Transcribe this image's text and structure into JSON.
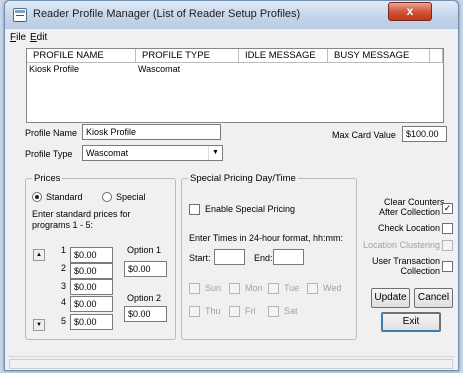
{
  "window": {
    "title": "Reader Profile Manager (List of Reader Setup Profiles)",
    "close_glyph": "x"
  },
  "menu": {
    "file": "File",
    "file_key": "F",
    "file_rest": "ile",
    "edit": "Edit",
    "edit_key": "E",
    "edit_rest": "dit"
  },
  "list": {
    "headers": [
      "PROFILE NAME",
      "PROFILE TYPE",
      "IDLE MESSAGE",
      "BUSY MESSAGE"
    ],
    "rows": [
      [
        "Kiosk Profile",
        "Wascomat",
        "",
        ""
      ]
    ]
  },
  "form": {
    "profile_name_label": "Profile Name",
    "profile_name_value": "Kiosk Profile",
    "profile_type_label": "Profile Type",
    "profile_type_value": "Wascomat",
    "max_card_label": "Max Card Value",
    "max_card_value": "$100.00"
  },
  "prices": {
    "title": "Prices",
    "standard_label": "Standard",
    "special_label": "Special",
    "selected": "standard",
    "instructions": "Enter standard prices for programs 1 - 5:",
    "programs": [
      {
        "num": "1",
        "value": "$0.00"
      },
      {
        "num": "2",
        "value": "$0.00"
      },
      {
        "num": "3",
        "value": "$0.00"
      },
      {
        "num": "4",
        "value": "$0.00"
      },
      {
        "num": "5",
        "value": "$0.00"
      }
    ],
    "option1_label": "Option 1",
    "option1_value": "$0.00",
    "option2_label": "Option 2",
    "option2_value": "$0.00"
  },
  "special": {
    "title": "Special Pricing Day/Time",
    "enable_label": "Enable Special Pricing",
    "enable_checked": false,
    "times_hint": "Enter Times in 24-hour format, hh:mm:",
    "start_label": "Start:",
    "end_label": "End:",
    "days": [
      "Sun",
      "Mon",
      "Tue",
      "Wed",
      "Thu",
      "Fri",
      "Sat"
    ]
  },
  "options": {
    "clear_counters": "Clear Counters After Collection",
    "clear_counters_line1": "Clear Counters",
    "clear_counters_line2": "After Collection",
    "clear_counters_checked": true,
    "check_location": "Check Location",
    "check_location_checked": false,
    "location_clustering": "Location Clustering",
    "location_clustering_checked": false,
    "user_transaction_line1": "User Transaction",
    "user_transaction_line2": "Collection",
    "user_transaction_checked": false
  },
  "buttons": {
    "update": "Update",
    "cancel": "Cancel",
    "exit": "Exit"
  }
}
